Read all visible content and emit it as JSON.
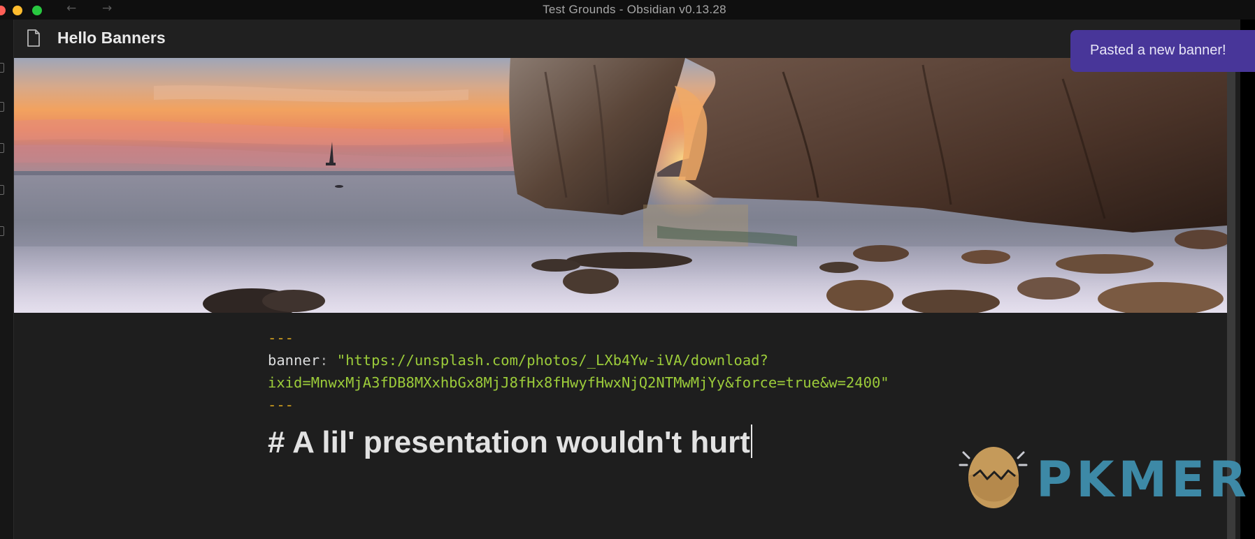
{
  "window": {
    "title": "Test Grounds - Obsidian v0.13.28",
    "back_arrow": "←",
    "forward_arrow": "→"
  },
  "note": {
    "title": "Hello Banners"
  },
  "editor": {
    "frontmatter_delimiter": "---",
    "banner_key": "banner",
    "banner_colon": ": ",
    "banner_value_line1": "\"https://unsplash.com/photos/_LXb4Yw-iVA/download?",
    "banner_value_line2": "ixid=MnwxMjA3fDB8MXxhbGx8MjJ8fHx8fHwyfHwxNjQ2NTMwMjYy&force=true&w=2400\"",
    "heading": "# A lil' presentation wouldn't hurt"
  },
  "notice": {
    "text": "Pasted a new banner!"
  },
  "watermark": {
    "text": "PKMER"
  },
  "icons": {
    "file": "file-icon",
    "ribbon": [
      "file-explorer-icon",
      "search-icon",
      "graph-icon",
      "calendar-icon",
      "plugin-icon"
    ]
  },
  "colors": {
    "notice_bg": "#483699",
    "frontmatter_delim": "#d4a11e",
    "frontmatter_value": "#9ccc3a",
    "editor_bg": "#1e1e1e",
    "watermark": "#3f8fae"
  }
}
